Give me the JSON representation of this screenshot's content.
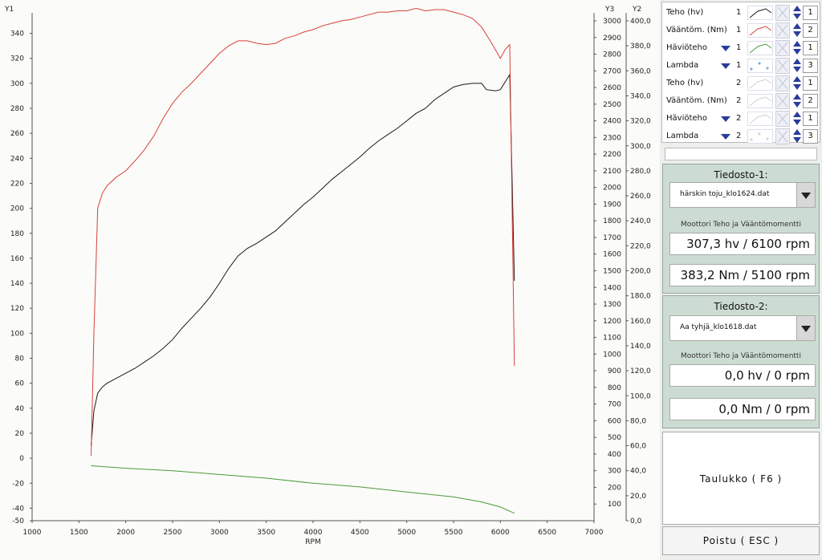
{
  "chart_data": {
    "type": "line",
    "xlabel": "RPM",
    "x_range": [
      1000,
      7000
    ],
    "x_ticks": [
      "1000",
      "1500",
      "2000",
      "2500",
      "3000",
      "3500",
      "4000",
      "4500",
      "5000",
      "5500",
      "6000",
      "6500",
      "7000"
    ],
    "y1": {
      "label": "Y1",
      "range": [
        -50,
        350
      ],
      "ticks": [
        "-50",
        "-40",
        "-20",
        "0",
        "20",
        "40",
        "60",
        "80",
        "100",
        "120",
        "140",
        "160",
        "180",
        "200",
        "220",
        "240",
        "260",
        "280",
        "300",
        "320",
        "340"
      ]
    },
    "y3": {
      "label": "Y3",
      "range": [
        0,
        3000
      ],
      "ticks": [
        "100",
        "200",
        "300",
        "400",
        "500",
        "600",
        "700",
        "800",
        "900",
        "1000",
        "1100",
        "1200",
        "1300",
        "1400",
        "1500",
        "1600",
        "1700",
        "1800",
        "1900",
        "2000",
        "2100",
        "2200",
        "2300",
        "2400",
        "2500",
        "2600",
        "2700",
        "2800",
        "2900",
        "3000"
      ]
    },
    "y2": {
      "label": "Y2",
      "range": [
        0,
        400
      ],
      "ticks": [
        "0,0",
        "20,0",
        "40,0",
        "60,0",
        "80,0",
        "100,0",
        "120,0",
        "140,0",
        "160,0",
        "180,0",
        "200,0",
        "220,0",
        "240,0",
        "260,0",
        "280,0",
        "300,0",
        "320,0",
        "340,0",
        "360,0",
        "380,0",
        "400,0"
      ]
    },
    "grid": false,
    "series": [
      {
        "name": "Teho (hv)",
        "axis": "y1",
        "color": "#1a1a1a",
        "points": [
          [
            1630,
            10
          ],
          [
            1660,
            38
          ],
          [
            1700,
            52
          ],
          [
            1750,
            57
          ],
          [
            1800,
            60
          ],
          [
            1900,
            64
          ],
          [
            2000,
            68
          ],
          [
            2100,
            72
          ],
          [
            2200,
            77
          ],
          [
            2300,
            82
          ],
          [
            2400,
            88
          ],
          [
            2500,
            95
          ],
          [
            2600,
            104
          ],
          [
            2700,
            112
          ],
          [
            2800,
            120
          ],
          [
            2900,
            129
          ],
          [
            3000,
            140
          ],
          [
            3100,
            152
          ],
          [
            3200,
            162
          ],
          [
            3300,
            168
          ],
          [
            3400,
            172
          ],
          [
            3500,
            177
          ],
          [
            3600,
            182
          ],
          [
            3700,
            189
          ],
          [
            3800,
            196
          ],
          [
            3900,
            203
          ],
          [
            4000,
            209
          ],
          [
            4100,
            216
          ],
          [
            4200,
            223
          ],
          [
            4300,
            229
          ],
          [
            4400,
            235
          ],
          [
            4500,
            241
          ],
          [
            4600,
            248
          ],
          [
            4700,
            254
          ],
          [
            4800,
            259
          ],
          [
            4900,
            264
          ],
          [
            5000,
            270
          ],
          [
            5100,
            276
          ],
          [
            5200,
            280
          ],
          [
            5300,
            287
          ],
          [
            5400,
            292
          ],
          [
            5500,
            297
          ],
          [
            5600,
            299
          ],
          [
            5700,
            300
          ],
          [
            5800,
            300
          ],
          [
            5850,
            295
          ],
          [
            5950,
            294
          ],
          [
            6000,
            295
          ],
          [
            6100,
            307
          ],
          [
            6150,
            142
          ]
        ]
      },
      {
        "name": "Vääntöm. (Nm)",
        "axis": "y2",
        "color": "#d8403a",
        "points": [
          [
            1630,
            52
          ],
          [
            1660,
            150
          ],
          [
            1700,
            250
          ],
          [
            1750,
            262
          ],
          [
            1800,
            268
          ],
          [
            1900,
            275
          ],
          [
            2000,
            280
          ],
          [
            2100,
            288
          ],
          [
            2200,
            297
          ],
          [
            2300,
            308
          ],
          [
            2400,
            322
          ],
          [
            2500,
            334
          ],
          [
            2600,
            343
          ],
          [
            2700,
            350
          ],
          [
            2800,
            358
          ],
          [
            2900,
            366
          ],
          [
            3000,
            374
          ],
          [
            3100,
            380
          ],
          [
            3200,
            384
          ],
          [
            3300,
            384
          ],
          [
            3400,
            382
          ],
          [
            3500,
            381
          ],
          [
            3600,
            382
          ],
          [
            3700,
            386
          ],
          [
            3800,
            388
          ],
          [
            3900,
            391
          ],
          [
            4000,
            393
          ],
          [
            4100,
            396
          ],
          [
            4200,
            398
          ],
          [
            4300,
            400
          ],
          [
            4400,
            401
          ],
          [
            4500,
            403
          ],
          [
            4600,
            405
          ],
          [
            4700,
            407
          ],
          [
            4800,
            407
          ],
          [
            4900,
            408
          ],
          [
            5000,
            408
          ],
          [
            5100,
            410
          ],
          [
            5200,
            408
          ],
          [
            5300,
            409
          ],
          [
            5400,
            409
          ],
          [
            5500,
            407
          ],
          [
            5600,
            405
          ],
          [
            5700,
            402
          ],
          [
            5800,
            395
          ],
          [
            5900,
            383
          ],
          [
            6000,
            370
          ],
          [
            6050,
            377
          ],
          [
            6100,
            381
          ],
          [
            6150,
            124
          ]
        ]
      },
      {
        "name": "Häviöteho",
        "axis": "y1",
        "color": "#4a9a3a",
        "points": [
          [
            1630,
            -6
          ],
          [
            2000,
            -8
          ],
          [
            2500,
            -10
          ],
          [
            3000,
            -13
          ],
          [
            3500,
            -16
          ],
          [
            4000,
            -20
          ],
          [
            4500,
            -23
          ],
          [
            5000,
            -27
          ],
          [
            5500,
            -31
          ],
          [
            5800,
            -35
          ],
          [
            6000,
            -39
          ],
          [
            6150,
            -44
          ]
        ]
      }
    ]
  },
  "legend": [
    {
      "name": "Teho (hv)",
      "file": "1",
      "color": "#1a1a1a",
      "dropdown": false,
      "axis": "1"
    },
    {
      "name": "Vääntöm. (Nm)",
      "file": "1",
      "color": "#d8403a",
      "dropdown": false,
      "axis": "2"
    },
    {
      "name": "Häviöteho",
      "file": "1",
      "color": "#4a9a3a",
      "dropdown": true,
      "axis": "1"
    },
    {
      "name": "Lambda",
      "file": "1",
      "color": "#6fa8d8",
      "dropdown": true,
      "axis": "3"
    },
    {
      "name": "Teho (hv)",
      "file": "2",
      "color": "#d0d0d0",
      "dropdown": false,
      "axis": "1"
    },
    {
      "name": "Vääntöm. (Nm)",
      "file": "2",
      "color": "#d0d0d0",
      "dropdown": false,
      "axis": "2"
    },
    {
      "name": "Häviöteho",
      "file": "2",
      "color": "#d0d0d0",
      "dropdown": true,
      "axis": "1"
    },
    {
      "name": "Lambda",
      "file": "2",
      "color": "#d0d0d0",
      "dropdown": true,
      "axis": "3"
    }
  ],
  "file1": {
    "title": "Tiedosto-1:",
    "filename": "härskin toju_klo1624.dat",
    "subtitle": "Moottori Teho ja Vääntömomentti",
    "power": "307,3 hv / 6100 rpm",
    "torque": "383,2 Nm / 5100 rpm"
  },
  "file2": {
    "title": "Tiedosto-2:",
    "filename": "Aa tyhjä_klo1618.dat",
    "subtitle": "Moottori Teho ja Vääntömomentti",
    "power": "0,0 hv / 0 rpm",
    "torque": "0,0 Nm / 0 rpm"
  },
  "buttons": {
    "table": "Taulukko ( F6 )",
    "exit": "Poistu ( ESC )"
  }
}
